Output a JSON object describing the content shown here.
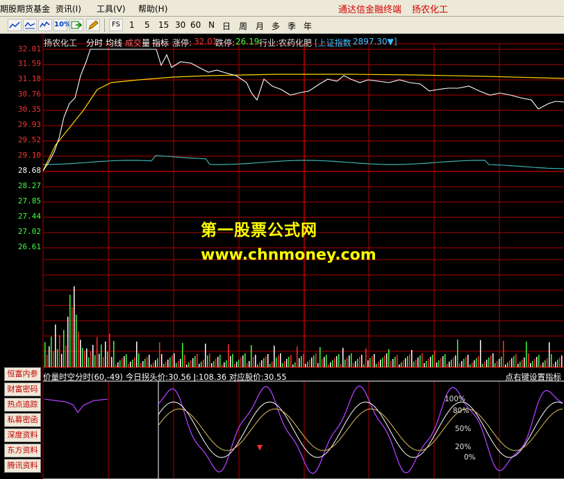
{
  "menu": {
    "items": [
      {
        "label": "期股期货基金"
      },
      {
        "label": "资讯(I)"
      },
      {
        "label": "工具(V)"
      },
      {
        "label": "帮助(H)"
      }
    ],
    "app_title": "通达信金融终端",
    "stock_title": "扬农化工"
  },
  "toolbar": {
    "percent_label": "10%",
    "fs_label": "FS",
    "periods": [
      "1",
      "5",
      "15",
      "30",
      "60",
      "N",
      "日",
      "周",
      "月",
      "多",
      "季",
      "年"
    ]
  },
  "info_bar": {
    "stock_name": "扬农化工",
    "mode": "分时",
    "avg_label": "均线",
    "vol_label_1": "成交",
    "vol_label_2": "量",
    "indicator_label": "指标",
    "limit_up_label": "涨停:",
    "limit_up_value": "32.01",
    "limit_down_label": "跌停:",
    "limit_down_value": "26.19",
    "industry": "行业:农药化肥",
    "index_label": "[上证指数",
    "index_value": "2897.30▼]"
  },
  "price_axis": [
    "32.01",
    "31.59",
    "31.18",
    "30.76",
    "30.35",
    "29.93",
    "29.52",
    "29.10",
    "28.68",
    "28.27",
    "27.85",
    "27.44",
    "27.02",
    "26.61"
  ],
  "watermark": {
    "line1": "第一股票公式网",
    "line2": "www.chnmoney.com"
  },
  "indicator": {
    "title": "价量时空分时(60,-49) 今日拐头价:30.56 J:108.36 对应股价:30.55",
    "hint": "点右键设置指标",
    "levels": [
      "100%",
      "80%",
      "50%",
      "20%",
      "0%"
    ]
  },
  "side_buttons": [
    "恒富内参",
    "财富密码",
    "热点追踪",
    "私募密函",
    "深度资料",
    "东方资料",
    "腾讯资料"
  ],
  "colors": {
    "grid": "#b00000",
    "price_line": "#ffffff",
    "avg_line": "#ffd700",
    "index_line": "#40b0b0",
    "up": "#ff3030",
    "down": "#40ff40",
    "indicator_purple": "#b040ff",
    "watermark": "#ffff00"
  }
}
